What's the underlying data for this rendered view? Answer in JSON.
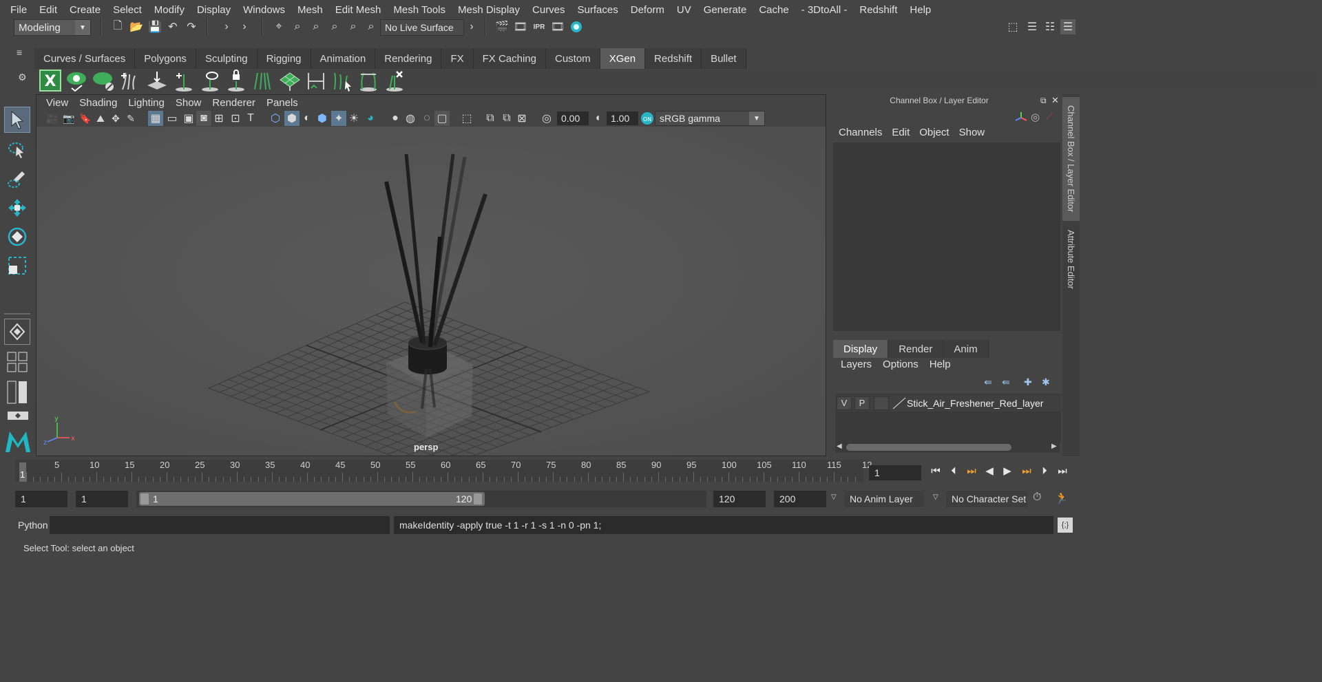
{
  "menubar": [
    "File",
    "Edit",
    "Create",
    "Select",
    "Modify",
    "Display",
    "Windows",
    "Mesh",
    "Edit Mesh",
    "Mesh Tools",
    "Mesh Display",
    "Curves",
    "Surfaces",
    "Deform",
    "UV",
    "Generate",
    "Cache",
    "- 3DtoAll -",
    "Redshift",
    "Help"
  ],
  "status": {
    "mode": "Modeling",
    "live_surface": "No Live Surface"
  },
  "shelf_tabs": [
    "Curves / Surfaces",
    "Polygons",
    "Sculpting",
    "Rigging",
    "Animation",
    "Rendering",
    "FX",
    "FX Caching",
    "Custom",
    "XGen",
    "Redshift",
    "Bullet"
  ],
  "shelf_active": "XGen",
  "viewport": {
    "menu": [
      "View",
      "Shading",
      "Lighting",
      "Show",
      "Renderer",
      "Panels"
    ],
    "exposure": "0.00",
    "gamma": "1.00",
    "color_space": "sRGB gamma",
    "camera_label": "persp"
  },
  "channel_box": {
    "title": "Channel Box / Layer Editor",
    "menu": [
      "Channels",
      "Edit",
      "Object",
      "Show"
    ]
  },
  "layer_editor": {
    "tabs": [
      "Display",
      "Render",
      "Anim"
    ],
    "active_tab": "Display",
    "menu": [
      "Layers",
      "Options",
      "Help"
    ],
    "layers": [
      {
        "v": "V",
        "p": "P",
        "name": "Stick_Air_Freshener_Red_layer"
      }
    ]
  },
  "side_tabs": [
    "Channel Box / Layer Editor",
    "Attribute Editor"
  ],
  "timeline": {
    "ticks": [
      "5",
      "10",
      "15",
      "20",
      "25",
      "30",
      "35",
      "40",
      "45",
      "50",
      "55",
      "60",
      "65",
      "70",
      "75",
      "80",
      "85",
      "90",
      "95",
      "100",
      "105",
      "110",
      "115",
      "12"
    ],
    "start_marker": "1",
    "current_frame": "1"
  },
  "range": {
    "start": "1",
    "playback_start": "1",
    "slider_start": "1",
    "slider_end": "120",
    "playback_end": "120",
    "end": "200",
    "anim_layer": "No Anim Layer",
    "character_set": "No Character Set"
  },
  "command": {
    "language": "Python",
    "result": "makeIdentity -apply true -t 1 -r 1 -s 1 -n 0 -pn 1;"
  },
  "help_line": "Select Tool: select an object",
  "icons": {
    "accent_green": "#3fae5a",
    "accent_teal": "#29b4c8"
  }
}
